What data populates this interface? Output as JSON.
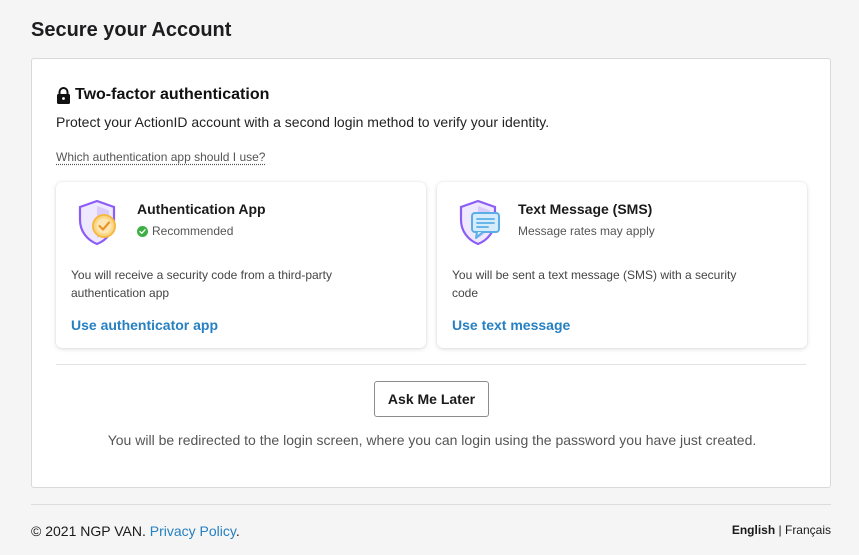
{
  "page": {
    "title": "Secure your Account"
  },
  "two_factor": {
    "heading": "Two-factor authentication",
    "description": "Protect your ActionID account with a second login method to verify your identity.",
    "help_link": "Which authentication app should I use?",
    "options": [
      {
        "title": "Authentication App",
        "subtitle": "Recommended",
        "subtitle_icon": "check-circle-icon",
        "description": "You will receive a security code from a third-party authentication app",
        "action": "Use authenticator app",
        "icon": "shield-check-icon"
      },
      {
        "title": "Text Message (SMS)",
        "subtitle": "Message rates may apply",
        "description": "You will be sent a text message (SMS) with a security code",
        "action": "Use text message",
        "icon": "shield-message-icon"
      }
    ],
    "ask_later_label": "Ask Me Later",
    "redirect_note": "You will be redirected to the login screen, where you can login using the password you have just created."
  },
  "footer": {
    "copyright": "© 2021 NGP VAN.",
    "privacy_link": "Privacy Policy",
    "period": ".",
    "lang_active": "English",
    "lang_separator": "|",
    "lang_other": "Français"
  },
  "colors": {
    "link": "#2680c2",
    "recommended_check": "#3cb043",
    "shield_purple": "#8b5cf6",
    "shield_gold": "#f5b942",
    "shield_blue": "#5aaee8"
  }
}
